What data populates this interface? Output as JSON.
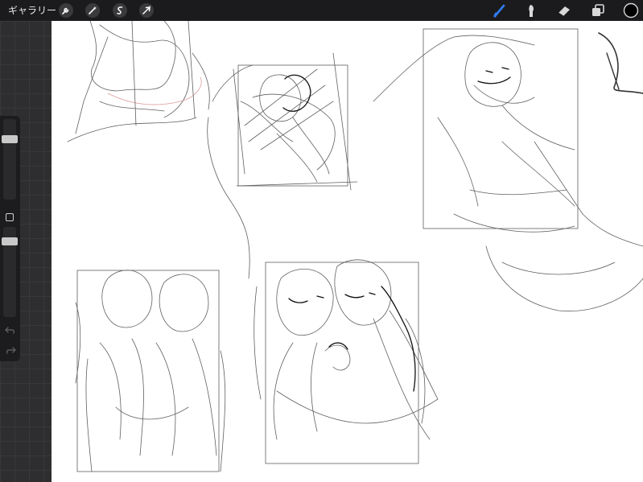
{
  "app": {
    "gallery_label": "ギャラリー"
  },
  "toolbar": {
    "left_tools": [
      "wrench-icon",
      "magic-wand-icon",
      "selection-icon",
      "transform-icon"
    ],
    "right_tools": [
      "brush-icon",
      "smudge-icon",
      "eraser-icon",
      "layers-icon",
      "color-swatch"
    ],
    "active_tool": "brush-icon",
    "current_color": "#000000",
    "brush_highlight": "#2f7cf6"
  },
  "sidebar": {
    "brush_size_level": 0.2,
    "opacity_level": 0.2
  }
}
